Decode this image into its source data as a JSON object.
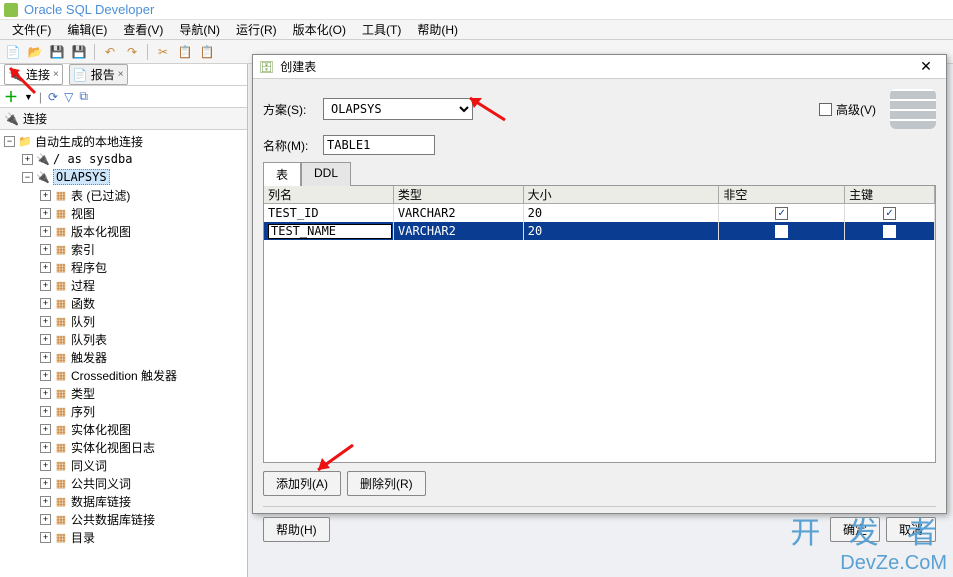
{
  "app": {
    "title": "Oracle SQL Developer"
  },
  "menu": {
    "file": "文件(F)",
    "edit": "编辑(E)",
    "view": "查看(V)",
    "nav": "导航(N)",
    "run": "运行(R)",
    "version": "版本化(O)",
    "tools": "工具(T)",
    "help": "帮助(H)"
  },
  "left": {
    "tabs": {
      "connections": "连接",
      "reports": "报告"
    },
    "panel_title": "连接",
    "root": "自动生成的本地连接",
    "conn1": "/ as sysdba",
    "conn2": "OLAPSYS",
    "nodes": [
      "表 (已过滤)",
      "视图",
      "版本化视图",
      "索引",
      "程序包",
      "过程",
      "函数",
      "队列",
      "队列表",
      "触发器",
      "Crossedition 触发器",
      "类型",
      "序列",
      "实体化视图",
      "实体化视图日志",
      "同义词",
      "公共同义词",
      "数据库链接",
      "公共数据库链接",
      "目录"
    ]
  },
  "dialog": {
    "title": "创建表",
    "schema_label": "方案(S):",
    "schema_value": "OLAPSYS",
    "name_label": "名称(M):",
    "name_value": "TABLE1",
    "advanced_label": "高级(V)",
    "tabs": {
      "table": "表",
      "ddl": "DDL"
    },
    "grid": {
      "headers": {
        "name": "列名",
        "type": "类型",
        "size": "大小",
        "notnull": "非空",
        "pk": "主键"
      },
      "rows": [
        {
          "name": "TEST_ID",
          "type": "VARCHAR2",
          "size": "20",
          "notnull": true,
          "pk": true
        },
        {
          "name": "TEST_NAME",
          "type": "VARCHAR2",
          "size": "20",
          "notnull": false,
          "pk": false
        }
      ]
    },
    "buttons": {
      "add_col": "添加列(A)",
      "del_col": "删除列(R)",
      "help": "帮助(H)",
      "ok": "确定",
      "cancel": "取消"
    }
  },
  "watermark": {
    "l1": "开 发 者",
    "l2": "DevZe.CoM"
  }
}
